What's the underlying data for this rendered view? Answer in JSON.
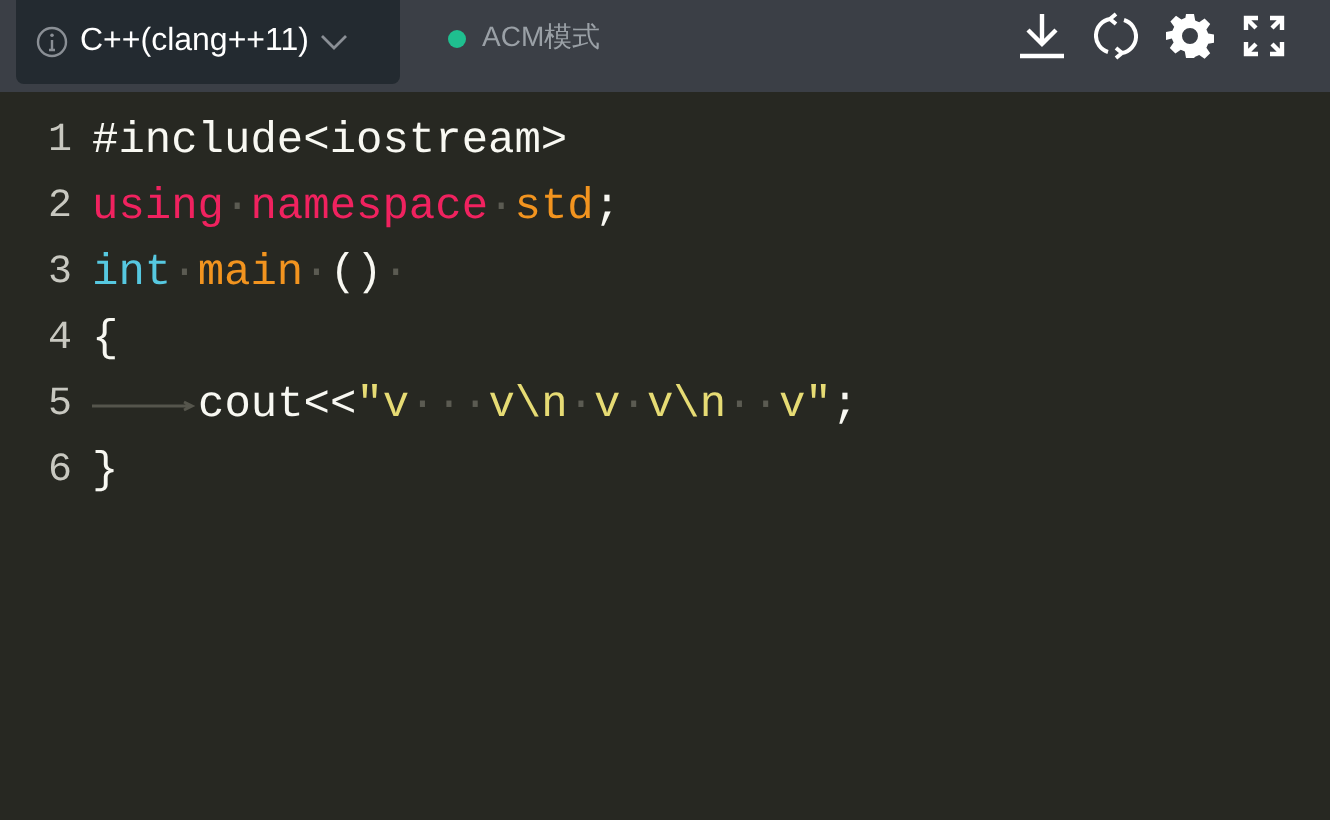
{
  "toolbar": {
    "language": "C++(clang++11)",
    "mode": {
      "label": "ACM模式",
      "color": "#1fbf8f"
    }
  },
  "editor": {
    "lines": [
      {
        "number": "1",
        "tokens": [
          {
            "kind": "plain",
            "text": "#include<iostream>"
          }
        ]
      },
      {
        "number": "2",
        "tokens": [
          {
            "kind": "keyword",
            "text": "using"
          },
          {
            "kind": "ws",
            "text": "·"
          },
          {
            "kind": "keyword",
            "text": "namespace"
          },
          {
            "kind": "ws",
            "text": "·"
          },
          {
            "kind": "name",
            "text": "std"
          },
          {
            "kind": "plain",
            "text": ";"
          }
        ]
      },
      {
        "number": "3",
        "tokens": [
          {
            "kind": "type",
            "text": "int"
          },
          {
            "kind": "ws",
            "text": "·"
          },
          {
            "kind": "name",
            "text": "main"
          },
          {
            "kind": "ws",
            "text": "·"
          },
          {
            "kind": "plain",
            "text": "()"
          },
          {
            "kind": "ws",
            "text": "·"
          }
        ]
      },
      {
        "number": "4",
        "tokens": [
          {
            "kind": "plain",
            "text": "{"
          }
        ]
      },
      {
        "number": "5",
        "tokens": [
          {
            "kind": "tab"
          },
          {
            "kind": "plain",
            "text": "cout<<"
          },
          {
            "kind": "string",
            "text": "\"v"
          },
          {
            "kind": "ws",
            "text": "···"
          },
          {
            "kind": "string",
            "text": "v\\n"
          },
          {
            "kind": "ws",
            "text": "·"
          },
          {
            "kind": "string",
            "text": "v"
          },
          {
            "kind": "ws",
            "text": "·"
          },
          {
            "kind": "string",
            "text": "v\\n"
          },
          {
            "kind": "ws",
            "text": "··"
          },
          {
            "kind": "string",
            "text": "v\""
          },
          {
            "kind": "plain",
            "text": ";"
          }
        ]
      },
      {
        "number": "6",
        "tokens": [
          {
            "kind": "plain",
            "text": "}"
          }
        ]
      }
    ]
  }
}
